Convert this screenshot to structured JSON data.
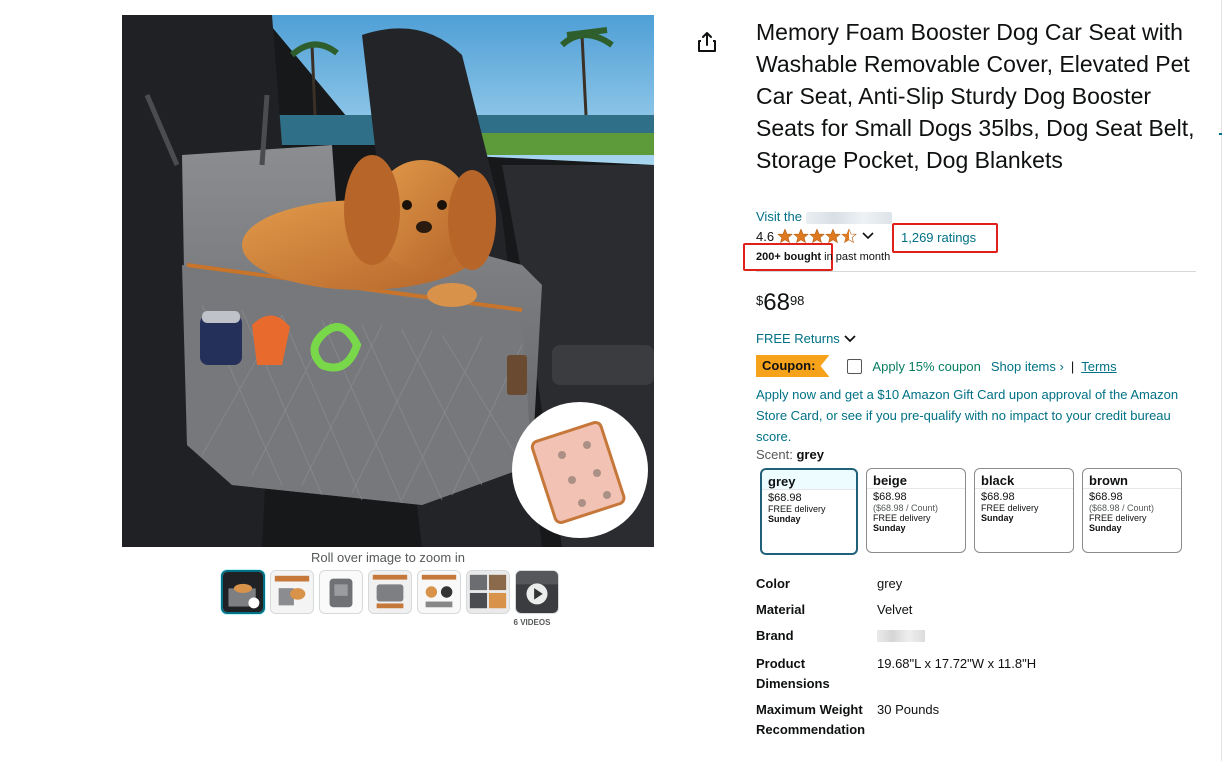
{
  "gallery": {
    "zoom_hint": "Roll over image to zoom in",
    "thumbnails": [
      "thumbnail-1",
      "thumbnail-2",
      "thumbnail-3",
      "thumbnail-4",
      "thumbnail-5",
      "thumbnail-6",
      "video-thumbnail"
    ],
    "video_count": "6 VIDEOS"
  },
  "product": {
    "title": "Memory Foam Booster Dog Car Seat with Washable Removable Cover, Elevated Pet Car Seat, Anti-Slip Sturdy Dog Booster Seats for Small Dogs 35lbs, Dog Seat Belt, Storage Pocket, Dog Blankets",
    "store_link_prefix": "Visit the ",
    "rating_value": "4.6",
    "rating_stars": 4.6,
    "ratings_count": "1,269 ratings",
    "bought_bold": "200+ bought",
    "bought_rest": " in past month",
    "price_symbol": "$",
    "price_whole": "68",
    "price_fraction": "98",
    "free_returns": "FREE Returns"
  },
  "coupon": {
    "badge": "Coupon:",
    "apply_label": "Apply 15% coupon",
    "shop_items": "Shop items ›",
    "separator": "|",
    "terms": "Terms"
  },
  "promo_text": "Apply now and get a $10 Amazon Gift Card upon approval of the Amazon Store Card, or see if you pre-qualify with no impact to your credit bureau score.",
  "scent": {
    "label": "Scent: ",
    "selected": "grey"
  },
  "variants": [
    {
      "name": "grey",
      "price": "$68.98",
      "count": "",
      "delivery": "FREE delivery",
      "day": "Sunday"
    },
    {
      "name": "beige",
      "price": "$68.98",
      "count": "($68.98 / Count)",
      "delivery": "FREE delivery",
      "day": "Sunday"
    },
    {
      "name": "black",
      "price": "$68.98",
      "count": "",
      "delivery": "FREE delivery",
      "day": "Sunday"
    },
    {
      "name": "brown",
      "price": "$68.98",
      "count": "($68.98 / Count)",
      "delivery": "FREE delivery",
      "day": "Sunday"
    }
  ],
  "specs": [
    {
      "key": "Color",
      "value": "grey"
    },
    {
      "key": "Material",
      "value": "Velvet"
    },
    {
      "key": "Brand",
      "value": ""
    },
    {
      "key": "Product Dimensions",
      "value": "19.68\"L x 17.72\"W x 11.8\"H"
    },
    {
      "key": "Maximum Weight Recommendation",
      "value": "30 Pounds"
    }
  ],
  "colors": {
    "link": "#007185",
    "coupon_badge": "#f7a21b",
    "coupon_apply": "#067d62",
    "highlight_box": "#e0201b",
    "star": "#de7921",
    "selected_variant_border": "#20607a"
  }
}
